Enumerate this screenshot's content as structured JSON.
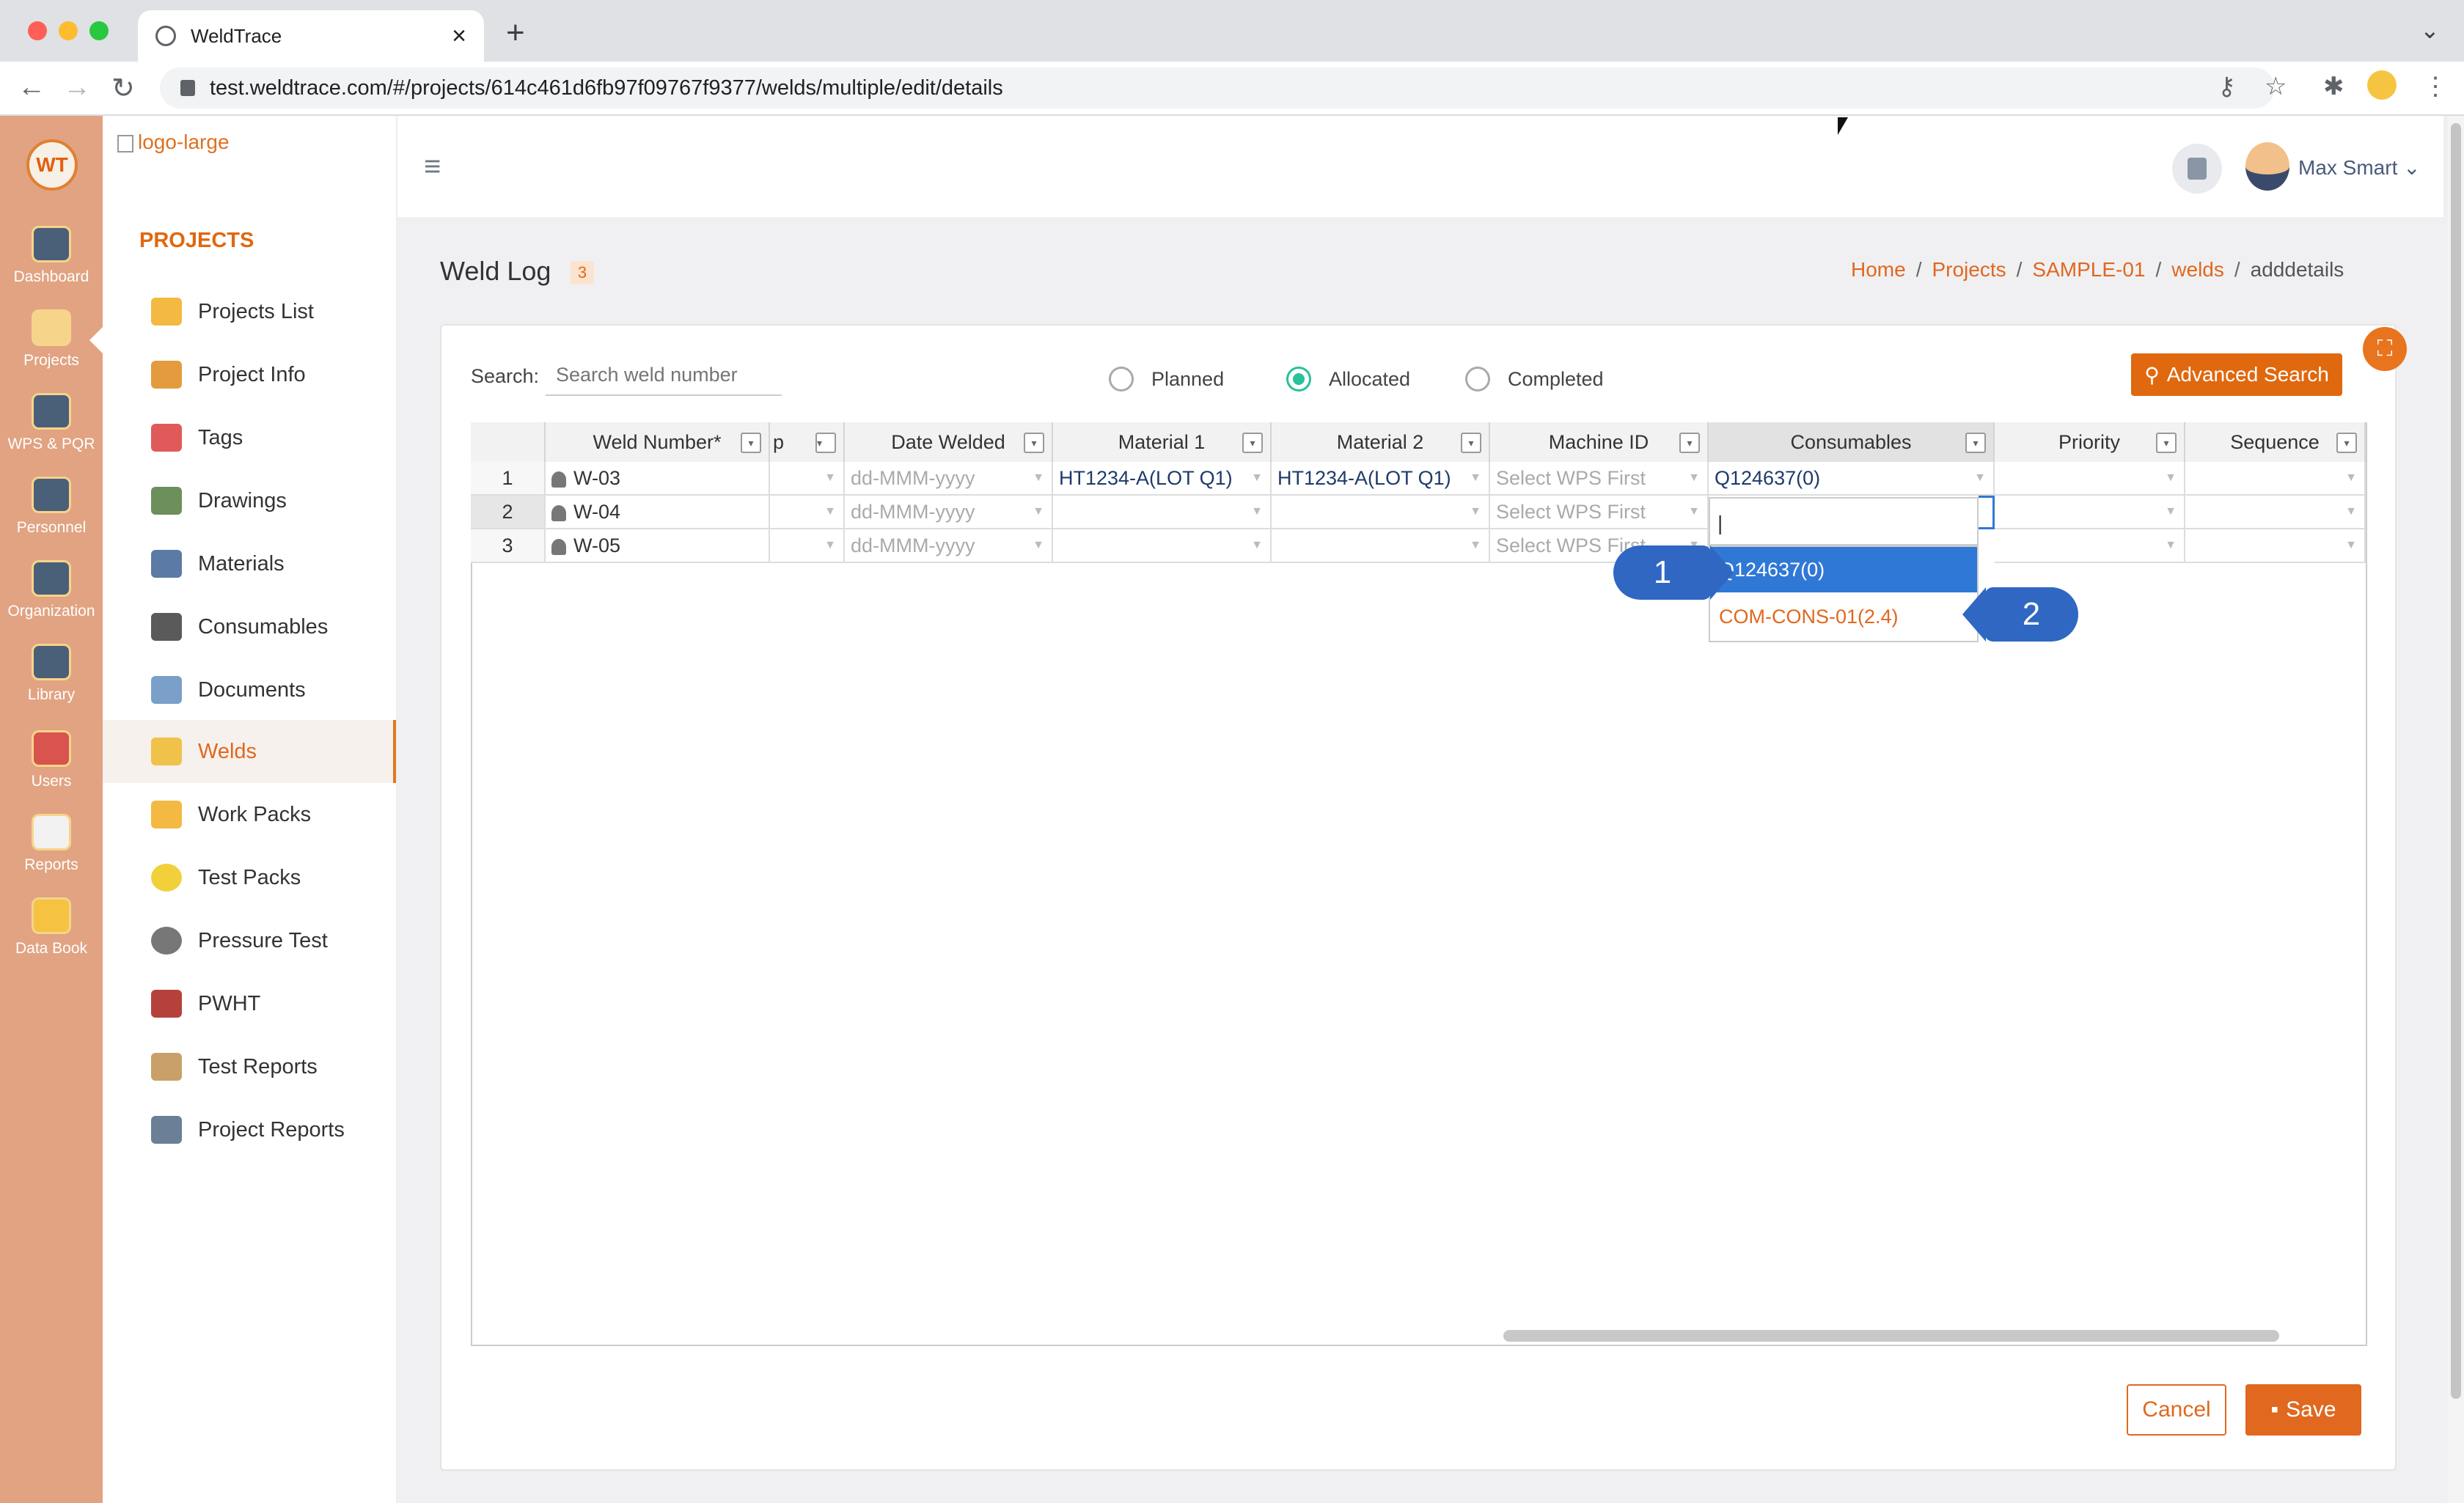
{
  "browser": {
    "tab_title": "WeldTrace",
    "url": "test.weldtrace.com/#/projects/614c461d6fb97f09767f9377/welds/multiple/edit/details",
    "tab_close": "×",
    "new_tab": "+",
    "tab_menu": "⌄",
    "back": "←",
    "forward": "→",
    "reload": "↻"
  },
  "rail": {
    "logo": "WT",
    "items": [
      {
        "label": "Dashboard"
      },
      {
        "label": "Projects"
      },
      {
        "label": "WPS & PQR"
      },
      {
        "label": "Personnel"
      },
      {
        "label": "Organization"
      },
      {
        "label": "Library"
      },
      {
        "label": "Users"
      },
      {
        "label": "Reports"
      },
      {
        "label": "Data Book"
      }
    ]
  },
  "sidebar": {
    "logo_alt": "logo-large",
    "section": "PROJECTS",
    "items": [
      {
        "label": "Projects List"
      },
      {
        "label": "Project Info"
      },
      {
        "label": "Tags"
      },
      {
        "label": "Drawings"
      },
      {
        "label": "Materials"
      },
      {
        "label": "Consumables"
      },
      {
        "label": "Documents"
      },
      {
        "label": "Welds",
        "active": true
      },
      {
        "label": "Work Packs"
      },
      {
        "label": "Test Packs"
      },
      {
        "label": "Pressure Test"
      },
      {
        "label": "PWHT"
      },
      {
        "label": "Test Reports"
      },
      {
        "label": "Project Reports"
      }
    ]
  },
  "header": {
    "menu": "≡",
    "user": "Max Smart ⌄"
  },
  "page": {
    "title": "Weld Log",
    "count": "3",
    "breadcrumb": [
      "Home",
      "Projects",
      "SAMPLE-01",
      "welds",
      "adddetails"
    ],
    "breadcrumb_sep": "/"
  },
  "filters": {
    "search_label": "Search:",
    "search_placeholder": "Search weld number",
    "radios": [
      {
        "label": "Planned",
        "selected": false
      },
      {
        "label": "Allocated",
        "selected": true
      },
      {
        "label": "Completed",
        "selected": false
      }
    ],
    "advanced_search": "Advanced Search"
  },
  "grid": {
    "columns": [
      "",
      "Weld Number*",
      "p",
      "Date Welded",
      "Material 1",
      "Material 2",
      "Machine ID",
      "Consumables",
      "Priority",
      "Sequence"
    ],
    "filter_glyph": "▾",
    "cell_arrow": "▼",
    "rows": [
      {
        "n": "1",
        "weld": "W-03",
        "date": "dd-MMM-yyyy",
        "mat1": "HT1234-A(LOT Q1)",
        "mat2": "HT1234-A(LOT Q1)",
        "machine": "Select WPS First",
        "consumable": "Q124637(0)"
      },
      {
        "n": "2",
        "weld": "W-04",
        "date": "dd-MMM-yyyy",
        "mat1": "",
        "mat2": "",
        "machine": "Select WPS First",
        "consumable": ""
      },
      {
        "n": "3",
        "weld": "W-05",
        "date": "dd-MMM-yyyy",
        "mat1": "",
        "mat2": "",
        "machine": "Select WPS First",
        "consumable": ""
      }
    ]
  },
  "dropdown": {
    "editor_text": "|",
    "options": [
      "Q124637(0)",
      "COM-CONS-01(2.4)"
    ]
  },
  "callouts": [
    "1",
    "2"
  ],
  "actions": {
    "cancel": "Cancel",
    "save": "Save"
  },
  "colors": {
    "accent": "#e0681f",
    "rail": "#e1a382",
    "selected": "#2f78d6",
    "radio_on": "#27c299"
  }
}
